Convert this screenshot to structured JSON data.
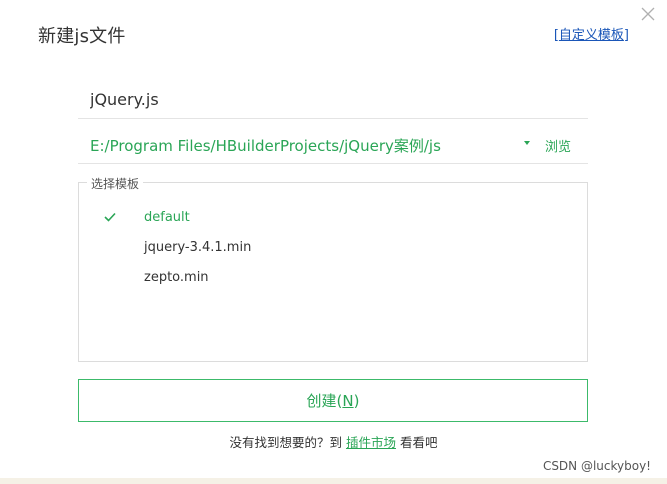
{
  "dialog": {
    "title": "新建js文件",
    "custom_template_link": "自定义模板",
    "bracket_open": "[",
    "bracket_close": "]"
  },
  "filename": {
    "value": "jQuery.js"
  },
  "path": {
    "value": "E:/Program Files/HBuilderProjects/jQuery案例/js",
    "browse_label": "浏览"
  },
  "templates": {
    "legend": "选择模板",
    "items": [
      {
        "name": "default",
        "selected": true
      },
      {
        "name": "jquery-3.4.1.min",
        "selected": false
      },
      {
        "name": "zepto.min",
        "selected": false
      }
    ]
  },
  "create_button": {
    "label": "创建(",
    "shortcut": "N",
    "label_end": ")"
  },
  "footer": {
    "prefix": "没有找到想要的？到 ",
    "link": "插件市场",
    "suffix": " 看看吧"
  },
  "watermark": "CSDN @luckyboy!",
  "colors": {
    "accent": "#2aa556",
    "link_blue": "#1a56b8",
    "border": "#dcdcdc"
  },
  "icons": [
    "close-icon",
    "check-icon",
    "dropdown-arrow-icon"
  ]
}
